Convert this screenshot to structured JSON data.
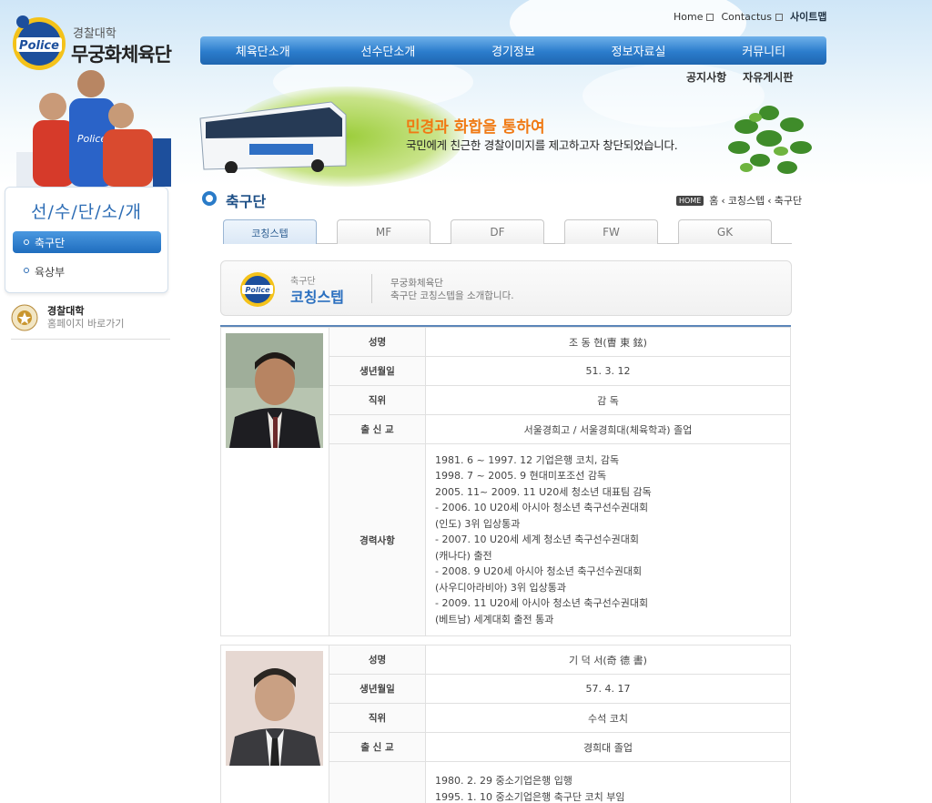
{
  "header": {
    "logo_sub": "경찰대학",
    "logo_title": "무궁화체육단",
    "util_links": [
      "Home",
      "Contactus",
      "사이트맵"
    ],
    "gnb": [
      "체육단소개",
      "선수단소개",
      "경기정보",
      "정보자료실",
      "커뮤니티"
    ],
    "sub_links": [
      "공지사항",
      "자유게시판"
    ],
    "slogan_1": "민경과 화합을 통하여",
    "slogan_2": "국민에게 친근한 경찰이미지를 제고하고자 창단되었습니다."
  },
  "sidebar": {
    "title": "선/수/단/소/개",
    "items": [
      {
        "label": "축구단",
        "active": true
      },
      {
        "label": "육상부",
        "active": false
      }
    ],
    "univ_name": "경찰대학",
    "univ_link": "홈페이지 바로가기"
  },
  "content": {
    "title": "축구단",
    "breadcrumb": [
      "HOME",
      "홈",
      "코칭스텝",
      "축구단"
    ],
    "tabs": [
      "코칭스텝",
      "MF",
      "DF",
      "FW",
      "GK"
    ],
    "intro_small": "축구단",
    "intro_big": "코칭스텝",
    "intro_line1": "무궁화체육단",
    "intro_line2": "축구단 코칭스텝을 소개합니다."
  },
  "labels": {
    "name": "성명",
    "birth": "생년월일",
    "position": "직위",
    "school": "출 신 교",
    "career": "경력사항"
  },
  "staff": [
    {
      "name": "조 동 현(曺 東 鉉)",
      "birth": "51. 3. 12",
      "position": "감 독",
      "school": "서울경희고 / 서울경희대(체육학과) 졸업",
      "career": [
        "1981. 6 ~ 1997. 12 기업은행 코치, 감독",
        "1998. 7 ~ 2005. 9 현대미포조선 감독",
        "2005. 11~ 2009. 11 U20세 청소년 대표팀 감독",
        "- 2006. 10 U20세 아시아 청소년 축구선수권대회",
        "(인도) 3위 입상통과",
        "- 2007. 10 U20세 세계 청소년 축구선수권대회",
        "(캐나다) 출전",
        "- 2008. 9 U20세 아시아 청소년 축구선수권대회",
        "(사우디아라비아) 3위 입상통과",
        "- 2009. 11 U20세 아시아 청소년 축구선수권대회",
        "(베트남) 세계대회 출전 통과"
      ]
    },
    {
      "name": "기 덕 서(奇 德 書)",
      "birth": "57. 4. 17",
      "position": "수석 코치",
      "school": "경희대 졸업",
      "career": [
        "1980. 2. 29 중소기업은행 입행",
        "1995. 1. 10 중소기업은행 축구단 코치 부임"
      ]
    }
  ],
  "colors": {
    "gnb_blue": "#2b7ccc",
    "title_blue": "#2d6db5",
    "slogan_orange": "#f07a14"
  }
}
